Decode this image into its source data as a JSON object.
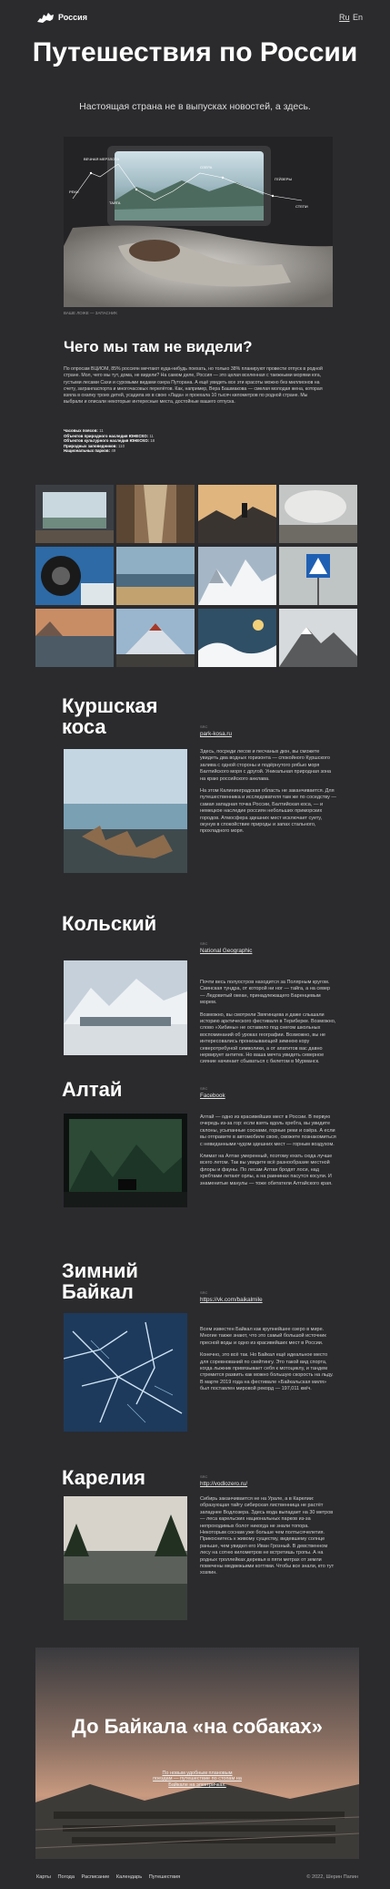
{
  "header": {
    "brand": "Россия",
    "lang_ru": "Ru",
    "lang_en": "En"
  },
  "hero": {
    "title": "Путешествия по России",
    "subtitle": "Настоящая страна не в выпусках новостей, а здесь.",
    "image_labels": [
      "ВЕЧНАЯ МЕРЗЛОТА",
      "РЕКИ",
      "ТАЙГА",
      "ГЕЙЗЕРЫ",
      "ОЗЕРА",
      "СТЕПИ"
    ],
    "caption": "ВАШЕ ЛОЖЕ — ЗАПАСНИК"
  },
  "intro": {
    "heading": "Чего мы там не видели?",
    "text": "По опросам ВЦИОМ, 85% россиян мечтают куда-нибудь поехать, но только 38% планируют провести отпуск в родной стране. Мол, чего мы тут, дома, не видели? На самом деле, Россия — это целая вселенная с таежными морями юга, густыми лесами Сахи и суровыми видами озера Путорана. А ещё увидеть все эти красоты можно без миллионов на счету, загранпаспорта и многочасовых перелётов. Как, например, Вера Башмакова — смелая молодая жена, которая взяла в охапку троих детей, усадила их в свою «Лада» и проехала 10 тысяч километров по родной стране. Мы выбрали и описали некоторые интересные места, достойные вашего отпуска.",
    "stats": [
      {
        "label": "Часовых поясов:",
        "value": "11"
      },
      {
        "label": "Объектов природного наследия ЮНЕСКО:",
        "value": "11"
      },
      {
        "label": "Объектов культурного наследия ЮНЕСКО:",
        "value": "18"
      },
      {
        "label": "Природных заповедников:",
        "value": "110"
      },
      {
        "label": "Национальных парков:",
        "value": "49"
      }
    ]
  },
  "gallery": {
    "tiles": [
      "window-view",
      "train-aisle",
      "mountain-sunset",
      "hot-springs",
      "car-wheel",
      "tundra-sea",
      "snowy-peaks",
      "road-sign",
      "lake-cliffs",
      "volcano",
      "ice-hills",
      "snowy-ridge"
    ]
  },
  "sections": [
    {
      "title": "Куршская коса",
      "source_label": "SRC",
      "source": "park-kosa.ru",
      "paragraphs": [
        "Здесь, посреди лесов и песчаных дюн, вы сможете увидеть два водных горизонта — спокойного Куршского залива с одной стороны и подёрнутого рябью моря Балтийского моря с другой. Уникальная природная зона на краю российского анклава.",
        "На этом Калининградская область не заканчивается. Для путешественника и исследователя там же по соседству — самая западная точка России, Балтийская коса, — и немецкое наследие россиян небольших приморских городов. Атмосфера здешних мест исключает суету, окунув в спокойствие природы и запах стального, прохладного моря."
      ]
    },
    {
      "title": "Кольский",
      "source_label": "SRC",
      "source": "National Geographic",
      "paragraphs": [
        "Почти весь полуостров находится за Полярным кругом. Свинская тундра, от которой ни ног — тайга, а на север — Ледовитый океан, принадлежащего Баренцевым морем.",
        "Возможно, вы смотрели Звягинцева и даже слышали историю арктического фестиваля в Териберке. Возможно, слово «Хибины» не оставило под снегом школьных воспоминаний об уроках географии. Возможно, вы не интересовались пронизывающей зимнюю кору северотребуной символики, а от апатитов вас давно нервирует антитек. Но ваша мечта увидеть северное сияние начинает сбываться с билетом в Мурманск."
      ]
    },
    {
      "title": "Алтай",
      "source_label": "SRC",
      "source": "Facebook",
      "paragraphs": [
        "Алтай — одно из красивейших мест в России. В первую очередь из-за гор: если взять вдоль хребта, вы увидите склоны, усыпанные соснами, горные реки и озёра. А если вы отправите в автомобиле свою, сможете познакомиться с невиданными чудом здешних мест — горным воздухом.",
        "Климат на Алтае умеренный, поэтому ехать сюда лучше всего летом. Так вы увидите всё разнообразие местной флоры и фауны. По лесам Алтая бродят лоси, над хребтами летают орлы, а на равнинах пасутся косули. И знаменитые манулы — тоже обитатели Алтайского края."
      ]
    },
    {
      "title": "Зимний Байкал",
      "source_label": "SRC",
      "source": "https://vk.com/baikalmile",
      "paragraphs": [
        "Всем известен Байкал как крупнейшее озеро в мире. Многие также знают, что это самый большой источник пресной воды и одно из красивейших мест в России.",
        "Конечно, это всё так. Но Байкал ещё идеальное место для соревнований по скейтингу. Это такой вид спорта, когда лыжник привязывает себя к мотоциклу, и тандем стремится развить как можно большую скорость на льду. В марте 2019 года на фестивале «Байкальская миля» был поставлен мировой рекорд — 197,011 км/ч."
      ]
    },
    {
      "title": "Карелия",
      "source_label": "SRC",
      "source": "http://vodlozero.ru/",
      "paragraphs": [
        "Сибирь заканчивается не на Урале, а в Карелии: образующая тайгу сибирская лиственница не растёт западнее Водлозера. Здесь вода выпадает на 30 метров — леса карельских национальных парков из-за непроходимых болот никогда не знали топора. Некоторым соснам уже больше чем полтысячелетия. Прикоснитесь к живому существу, видевшему солнце раньше, чем увидел его Иван Грозный. В девственном лесу на сотню километров не встретишь тропы. А на родных троллейках деревья в пяти метрах от земли помечены медвежьими когтями. Чтобы все знали, кто тут хозяин."
      ]
    }
  ],
  "promo": {
    "title": "До Байкала «на собаках»",
    "subtitle": "По новым удобным плановым поездам — путешествие по стопам на Байкале на электричках."
  },
  "footer": {
    "links": [
      "Карты",
      "Погода",
      "Расписание",
      "Календарь",
      "Путешествия"
    ],
    "copyright": "© 2022, Шерин Папин"
  }
}
